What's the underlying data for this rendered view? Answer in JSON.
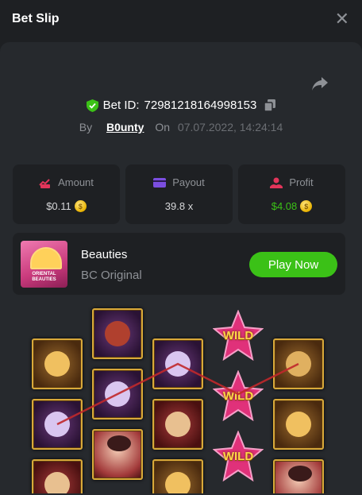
{
  "header": {
    "title": "Bet Slip",
    "close_label": "✕"
  },
  "bet": {
    "id_label": "Bet ID:",
    "id": "72981218164998153",
    "by_label": "By",
    "user": "B0unty",
    "on_label": "On",
    "date": "07.07.2022, 14:24:14"
  },
  "stats": {
    "amount": {
      "label": "Amount",
      "value": "$0.11"
    },
    "payout": {
      "label": "Payout",
      "value": "39.8 x"
    },
    "profit": {
      "label": "Profit",
      "value": "$4.08"
    }
  },
  "game": {
    "name": "Beauties",
    "provider": "BC Original",
    "play_label": "Play Now",
    "thumb_text": "ORIENTAL BEAUTIES"
  },
  "reels": {
    "wild_label": "WILD",
    "colors": {
      "frame": "#d9a93a",
      "payline": "#c0282b",
      "wild": "#e0317a"
    }
  },
  "colors": {
    "accent_green": "#3bc117",
    "background": "#1e2023",
    "panel": "#26292d"
  }
}
